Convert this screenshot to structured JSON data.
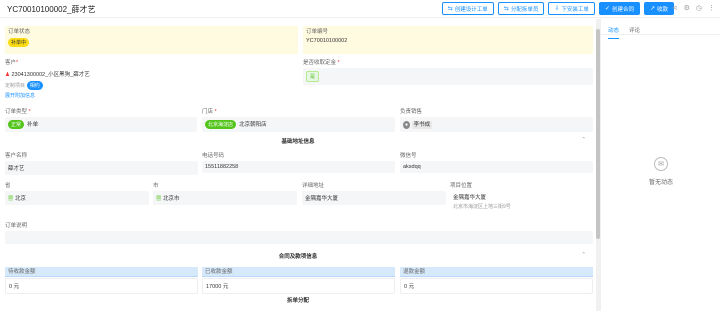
{
  "header": {
    "title": "YC70010100002_薛才艺",
    "buttons": [
      {
        "label": "创建设计工单",
        "icon": "⇆"
      },
      {
        "label": "分配拆单员",
        "icon": "⇆"
      },
      {
        "label": "下安装工单",
        "icon": "⇩"
      },
      {
        "label": "创建合同",
        "icon": "✓"
      },
      {
        "label": "收款",
        "icon": "↗"
      }
    ]
  },
  "side": {
    "tabs": [
      "动态",
      "评论"
    ],
    "empty_text": "暂无动态"
  },
  "fields": {
    "order_status": {
      "label": "订单状态",
      "value": "补单中"
    },
    "order_no": {
      "label": "订单编号",
      "value": "YC70010100002"
    },
    "customer": {
      "label": "客户",
      "name": "23041300002_小区黑狗_薛才艺",
      "sub": "定制项目",
      "tag": "相约",
      "link": "展开附加信息"
    },
    "deposit": {
      "label": "是否收取定金",
      "value": "是"
    },
    "order_type": {
      "label": "订单类型",
      "tag": "正常",
      "value": "补单"
    },
    "store": {
      "label": "门店",
      "tag": "北京海淀店",
      "value": "北京朝阳店"
    },
    "sales": {
      "label": "负责销售",
      "value": "李书成"
    },
    "section_basic": "基础地址信息",
    "cust_name": {
      "label": "客户名称",
      "value": "薛才艺"
    },
    "phone": {
      "label": "电话号码",
      "value": "15511882258"
    },
    "wechat": {
      "label": "微信号",
      "value": "aksdqq"
    },
    "province": {
      "label": "省",
      "value": "北京"
    },
    "city": {
      "label": "市",
      "value": "北京市"
    },
    "address": {
      "label": "详细地址",
      "value": "金隅嘉华大厦"
    },
    "location": {
      "label": "项目位置",
      "value": "金隅嘉华大厦",
      "sub": "北京市海淀区上地三街9号"
    },
    "order_note": {
      "label": "订单说明",
      "value": ""
    },
    "section_contract": "合同及款项信息",
    "pending": {
      "label": "待收款金额",
      "value": "0 元"
    },
    "received": {
      "label": "已收款金额",
      "value": "17000 元"
    },
    "refund": {
      "label": "退款金额",
      "value": "0 元"
    },
    "section_split": "拆单分配"
  }
}
